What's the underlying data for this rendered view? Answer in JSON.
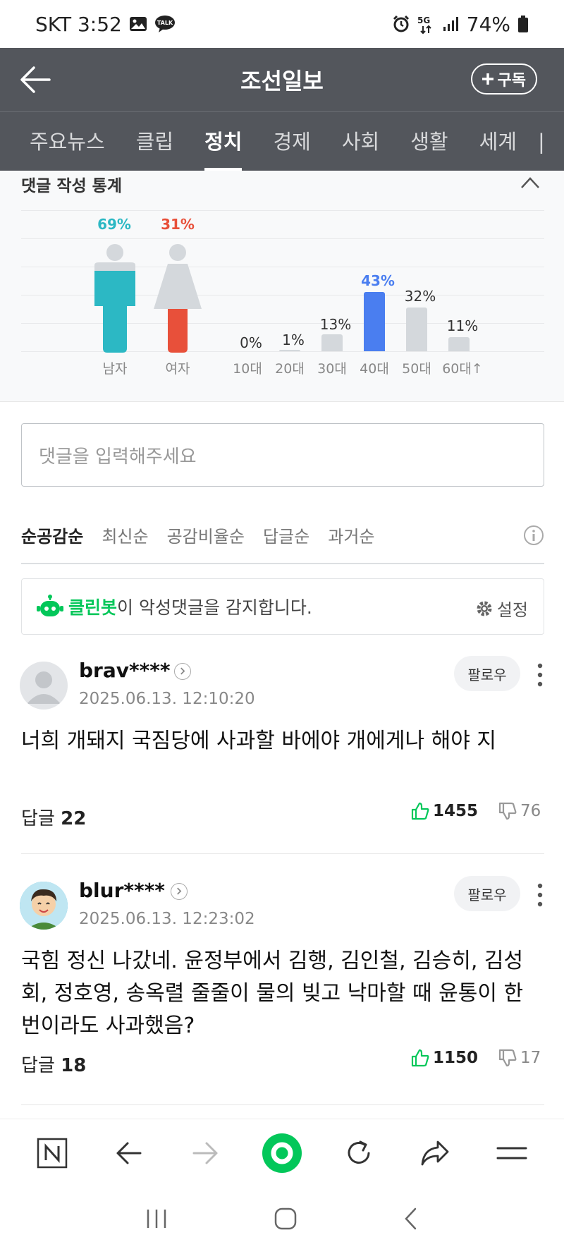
{
  "status_bar": {
    "carrier_time": "SKT 3:52",
    "talk": "TALK",
    "network": "5G",
    "battery": "74%"
  },
  "header": {
    "title": "조선일보",
    "subscribe_label": "구독"
  },
  "tabs": [
    "주요뉴스",
    "클립",
    "정치",
    "경제",
    "사회",
    "생활",
    "세계"
  ],
  "active_tab": "정치",
  "stats": {
    "title": "댓글 작성 통계",
    "gender": {
      "male_label": "남자",
      "male_pct": "69%",
      "female_label": "여자",
      "female_pct": "31%",
      "male_color": "#2cb8c4",
      "female_color": "#e8503a"
    },
    "age_labels": [
      "10대",
      "20대",
      "30대",
      "40대",
      "50대",
      "60대↑"
    ],
    "age_pcts": [
      "0%",
      "1%",
      "13%",
      "43%",
      "32%",
      "11%"
    ],
    "highlight_color": "#4a7ef0"
  },
  "chart_data": {
    "type": "bar",
    "categories": [
      "10대",
      "20대",
      "30대",
      "40대",
      "50대",
      "60대↑"
    ],
    "values": [
      0,
      1,
      13,
      43,
      32,
      11
    ],
    "gender": {
      "categories": [
        "남자",
        "여자"
      ],
      "values": [
        69,
        31
      ]
    },
    "title": "댓글 작성 통계"
  },
  "comment_input": {
    "placeholder": "댓글을 입력해주세요"
  },
  "sort": [
    "순공감순",
    "최신순",
    "공감비율순",
    "답글순",
    "과거순"
  ],
  "cleanbot": {
    "brand": "클린봇",
    "text": "이 악성댓글을 감지합니다.",
    "settings": "설정"
  },
  "comments": [
    {
      "user": "brav****",
      "time": "2025.06.13. 12:10:20",
      "follow": "팔로우",
      "text": "너희 개돼지 국짐당에 사과할 바에야 개에게나 해야 지",
      "reply_label": "답글",
      "reply_count": "22",
      "likes": "1455",
      "dislikes": "76"
    },
    {
      "user": "blur****",
      "time": "2025.06.13. 12:23:02",
      "follow": "팔로우",
      "text": "국힘 정신 나갔네. 윤정부에서 김행, 김인철, 김승히, 김성회, 정호영, 송옥렬 줄줄이 물의 빚고 낙마할 때 윤통이 한번이라도 사과했음?",
      "reply_label": "답글",
      "reply_count": "18",
      "likes": "1150",
      "dislikes": "17"
    }
  ]
}
